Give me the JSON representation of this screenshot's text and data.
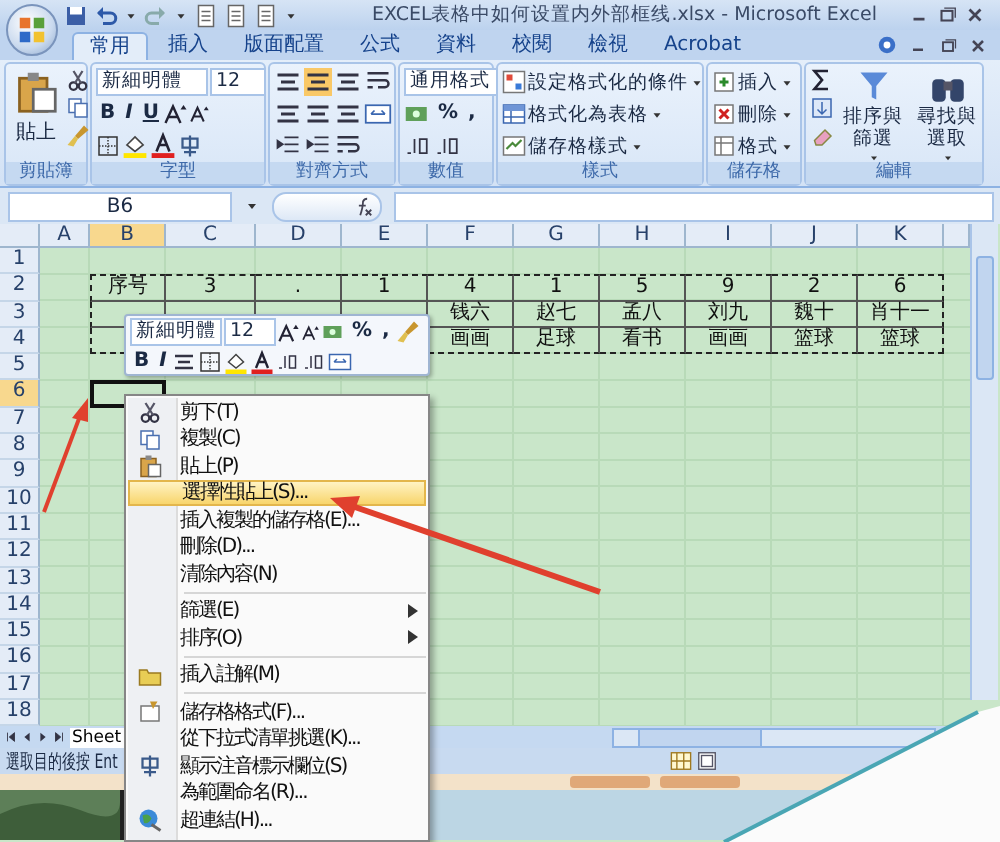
{
  "window": {
    "title": "EXCEL表格中如何设置内外部框线.xlsx - Microsoft Excel"
  },
  "tabs": [
    {
      "label": "常用",
      "selected": true
    },
    {
      "label": "插入",
      "selected": false
    },
    {
      "label": "版面配置",
      "selected": false
    },
    {
      "label": "公式",
      "selected": false
    },
    {
      "label": "資料",
      "selected": false
    },
    {
      "label": "校閱",
      "selected": false
    },
    {
      "label": "檢視",
      "selected": false
    },
    {
      "label": "Acrobat",
      "selected": false
    }
  ],
  "ribbon": {
    "groups": [
      {
        "kind": "clipboard",
        "label": "剪貼簿",
        "paste": "貼上"
      },
      {
        "kind": "font",
        "label": "字型",
        "font": "新細明體",
        "size": "12",
        "bold": "B",
        "italic": "I",
        "underline": "U"
      },
      {
        "kind": "alignment",
        "label": "對齊方式"
      },
      {
        "kind": "number",
        "label": "數值",
        "format": "通用格式",
        "percent": "%",
        "comma": ","
      },
      {
        "kind": "styles",
        "label": "樣式",
        "items": [
          "設定格式化的條件",
          "格式化為表格",
          "儲存格樣式"
        ]
      },
      {
        "kind": "cells",
        "label": "儲存格",
        "items": [
          "插入",
          "刪除",
          "格式"
        ]
      },
      {
        "kind": "editing",
        "label": "編輯",
        "items": [
          "排序與篩選",
          "尋找與選取"
        ]
      }
    ]
  },
  "formula_bar": {
    "name_box": "B6"
  },
  "columns": [
    {
      "label": "A",
      "selected": false
    },
    {
      "label": "B",
      "selected": true
    },
    {
      "label": "C",
      "selected": false
    },
    {
      "label": "D",
      "selected": false
    },
    {
      "label": "E",
      "selected": false
    },
    {
      "label": "F",
      "selected": false
    },
    {
      "label": "G",
      "selected": false
    },
    {
      "label": "H",
      "selected": false
    },
    {
      "label": "I",
      "selected": false
    },
    {
      "label": "J",
      "selected": false
    },
    {
      "label": "K",
      "selected": false
    }
  ],
  "rows": [
    {
      "label": "1",
      "selected": false
    },
    {
      "label": "2",
      "selected": false,
      "cells": [
        "序号",
        "3",
        ".",
        "1",
        "4",
        "1",
        "5",
        "9",
        "2",
        "6"
      ]
    },
    {
      "label": "3",
      "selected": false,
      "cells": [
        null,
        null,
        null,
        null,
        "钱六",
        "赵七",
        "孟八",
        "刘九",
        "魏十",
        "肖十一"
      ]
    },
    {
      "label": "4",
      "selected": false,
      "cells": [
        null,
        null,
        null,
        null,
        "画画",
        "足球",
        "看书",
        "画画",
        "篮球",
        "篮球"
      ]
    },
    {
      "label": "5",
      "selected": false
    },
    {
      "label": "6",
      "selected": true
    },
    {
      "label": "7",
      "selected": false
    },
    {
      "label": "8",
      "selected": false
    },
    {
      "label": "9",
      "selected": false
    },
    {
      "label": "10",
      "selected": false
    },
    {
      "label": "11",
      "selected": false
    },
    {
      "label": "12",
      "selected": false
    },
    {
      "label": "13",
      "selected": false
    },
    {
      "label": "14",
      "selected": false
    },
    {
      "label": "15",
      "selected": false
    },
    {
      "label": "16",
      "selected": false
    },
    {
      "label": "17",
      "selected": false
    },
    {
      "label": "18",
      "selected": false
    }
  ],
  "copy_range": {
    "copied": true
  },
  "mini_toolbar": {
    "font": "新細明體",
    "size": "12",
    "percent": "%",
    "comma": ",",
    "bold": "B",
    "italic": "I"
  },
  "context_menu": {
    "items": [
      {
        "kind": "item",
        "label": "剪下(T)",
        "highlighted": false
      },
      {
        "kind": "item",
        "label": "複製(C)",
        "highlighted": false
      },
      {
        "kind": "item",
        "label": "貼上(P)",
        "highlighted": false
      },
      {
        "kind": "item",
        "label": "選擇性貼上(S)...",
        "highlighted": true
      },
      {
        "kind": "item",
        "label": "插入複製的儲存格(E)...",
        "highlighted": false
      },
      {
        "kind": "item",
        "label": "刪除(D)...",
        "highlighted": false
      },
      {
        "kind": "item",
        "label": "清除內容(N)",
        "highlighted": false
      },
      {
        "kind": "separator"
      },
      {
        "kind": "submenu",
        "label": "篩選(E)",
        "highlighted": false
      },
      {
        "kind": "submenu",
        "label": "排序(O)",
        "highlighted": false
      },
      {
        "kind": "separator"
      },
      {
        "kind": "item",
        "label": "插入註解(M)",
        "highlighted": false
      },
      {
        "kind": "separator"
      },
      {
        "kind": "item",
        "label": "儲存格格式(F)...",
        "highlighted": false
      },
      {
        "kind": "item",
        "label": "從下拉式清單挑選(K)...",
        "highlighted": false
      },
      {
        "kind": "item",
        "label": "顯示注音標示欄位(S)",
        "highlighted": false
      },
      {
        "kind": "item",
        "label": "為範圍命名(R)...",
        "highlighted": false
      },
      {
        "kind": "item",
        "label": "超連結(H)...",
        "highlighted": false
      }
    ]
  },
  "sheet_tabs": [
    {
      "label": "Sheet"
    }
  ],
  "status_bar": {
    "text": "選取目的後按 Ent"
  }
}
